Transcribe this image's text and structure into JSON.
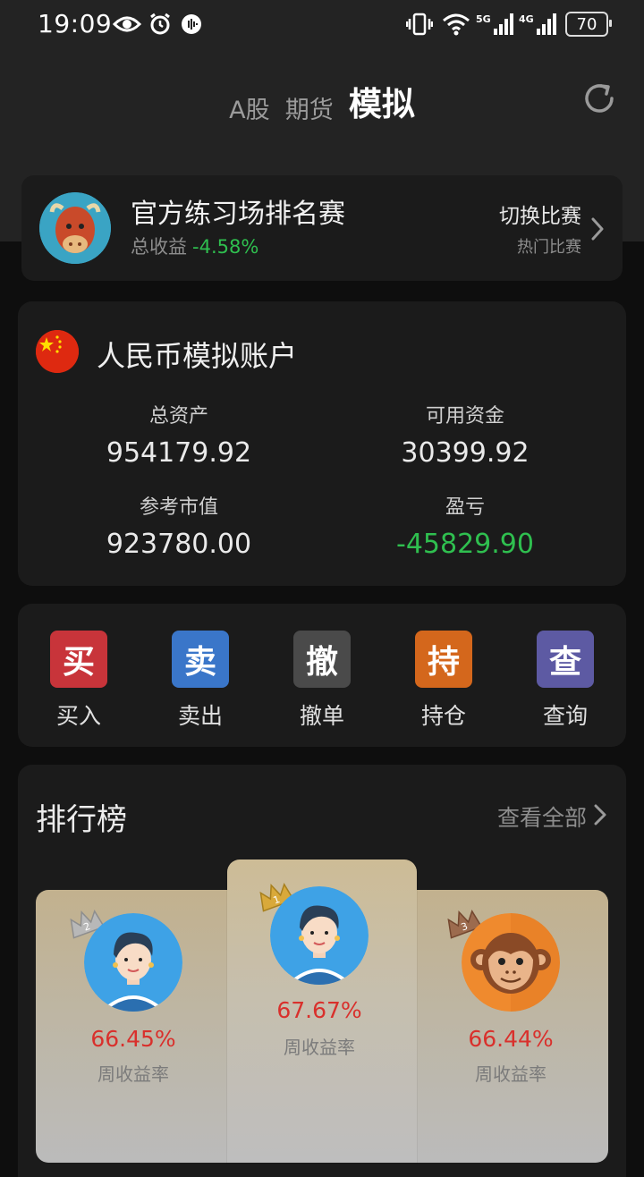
{
  "status_bar": {
    "time": "19:09",
    "battery": "70",
    "net_5g": "5G",
    "net_4g": "4G"
  },
  "tabs": [
    {
      "label": "A股",
      "active": false
    },
    {
      "label": "期货",
      "active": false
    },
    {
      "label": "模拟",
      "active": true
    }
  ],
  "contest": {
    "title": "官方练习场排名赛",
    "yield_label": "总收益",
    "yield_value": "-4.58%",
    "switch_label": "切换比赛",
    "switch_sub": "热门比赛"
  },
  "account": {
    "name": "人民币模拟账户",
    "total_assets_label": "总资产",
    "total_assets": "954179.92",
    "available_label": "可用资金",
    "available": "30399.92",
    "market_value_label": "参考市值",
    "market_value": "923780.00",
    "pnl_label": "盈亏",
    "pnl": "-45829.90"
  },
  "actions": [
    {
      "icon_char": "买",
      "label": "买入",
      "color": "#c8343a"
    },
    {
      "icon_char": "卖",
      "label": "卖出",
      "color": "#3a76c9"
    },
    {
      "icon_char": "撤",
      "label": "撤单",
      "color": "#4a4a4a"
    },
    {
      "icon_char": "持",
      "label": "持仓",
      "color": "#d4671c"
    },
    {
      "icon_char": "查",
      "label": "查询",
      "color": "#5d5aa3"
    }
  ],
  "ranking": {
    "title": "排行榜",
    "view_all": "查看全部",
    "entries": [
      {
        "rank": "2",
        "pct": "66.45%",
        "label": "周收益率"
      },
      {
        "rank": "1",
        "pct": "67.67%",
        "label": "周收益率"
      },
      {
        "rank": "3",
        "pct": "66.44%",
        "label": "周收益率"
      }
    ]
  },
  "colors": {
    "up_red": "#d9302c",
    "down_green": "#2fbf4f"
  }
}
